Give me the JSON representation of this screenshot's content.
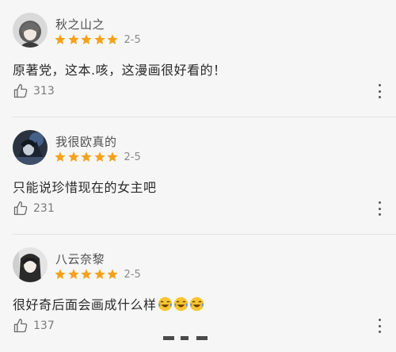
{
  "comments": [
    {
      "username": "秋之山之",
      "stars": 5,
      "chapter": "2-5",
      "text": "原著党，这本.咳，这漫画很好看的！",
      "likes": "313"
    },
    {
      "username": "我很欧真的",
      "stars": 5,
      "chapter": "2-5",
      "text": "只能说珍惜现在的女主吧",
      "likes": "231"
    },
    {
      "username": "八云奈黎",
      "stars": 5,
      "chapter": "2-5",
      "text": "很好奇后面会画成什么样",
      "emoji": [
        "laughing-tears-emoji",
        "laughing-tears-emoji",
        "laughing-tears-emoji"
      ],
      "likes": "137"
    }
  ],
  "colors": {
    "background": "#f6f6f6",
    "star": "#f4a21d",
    "text": "#2a2a2a",
    "muted": "#8a8a8a"
  },
  "icons": {
    "like": "thumbs-up-icon",
    "more": "more-vertical-icon",
    "star": "star-icon"
  }
}
